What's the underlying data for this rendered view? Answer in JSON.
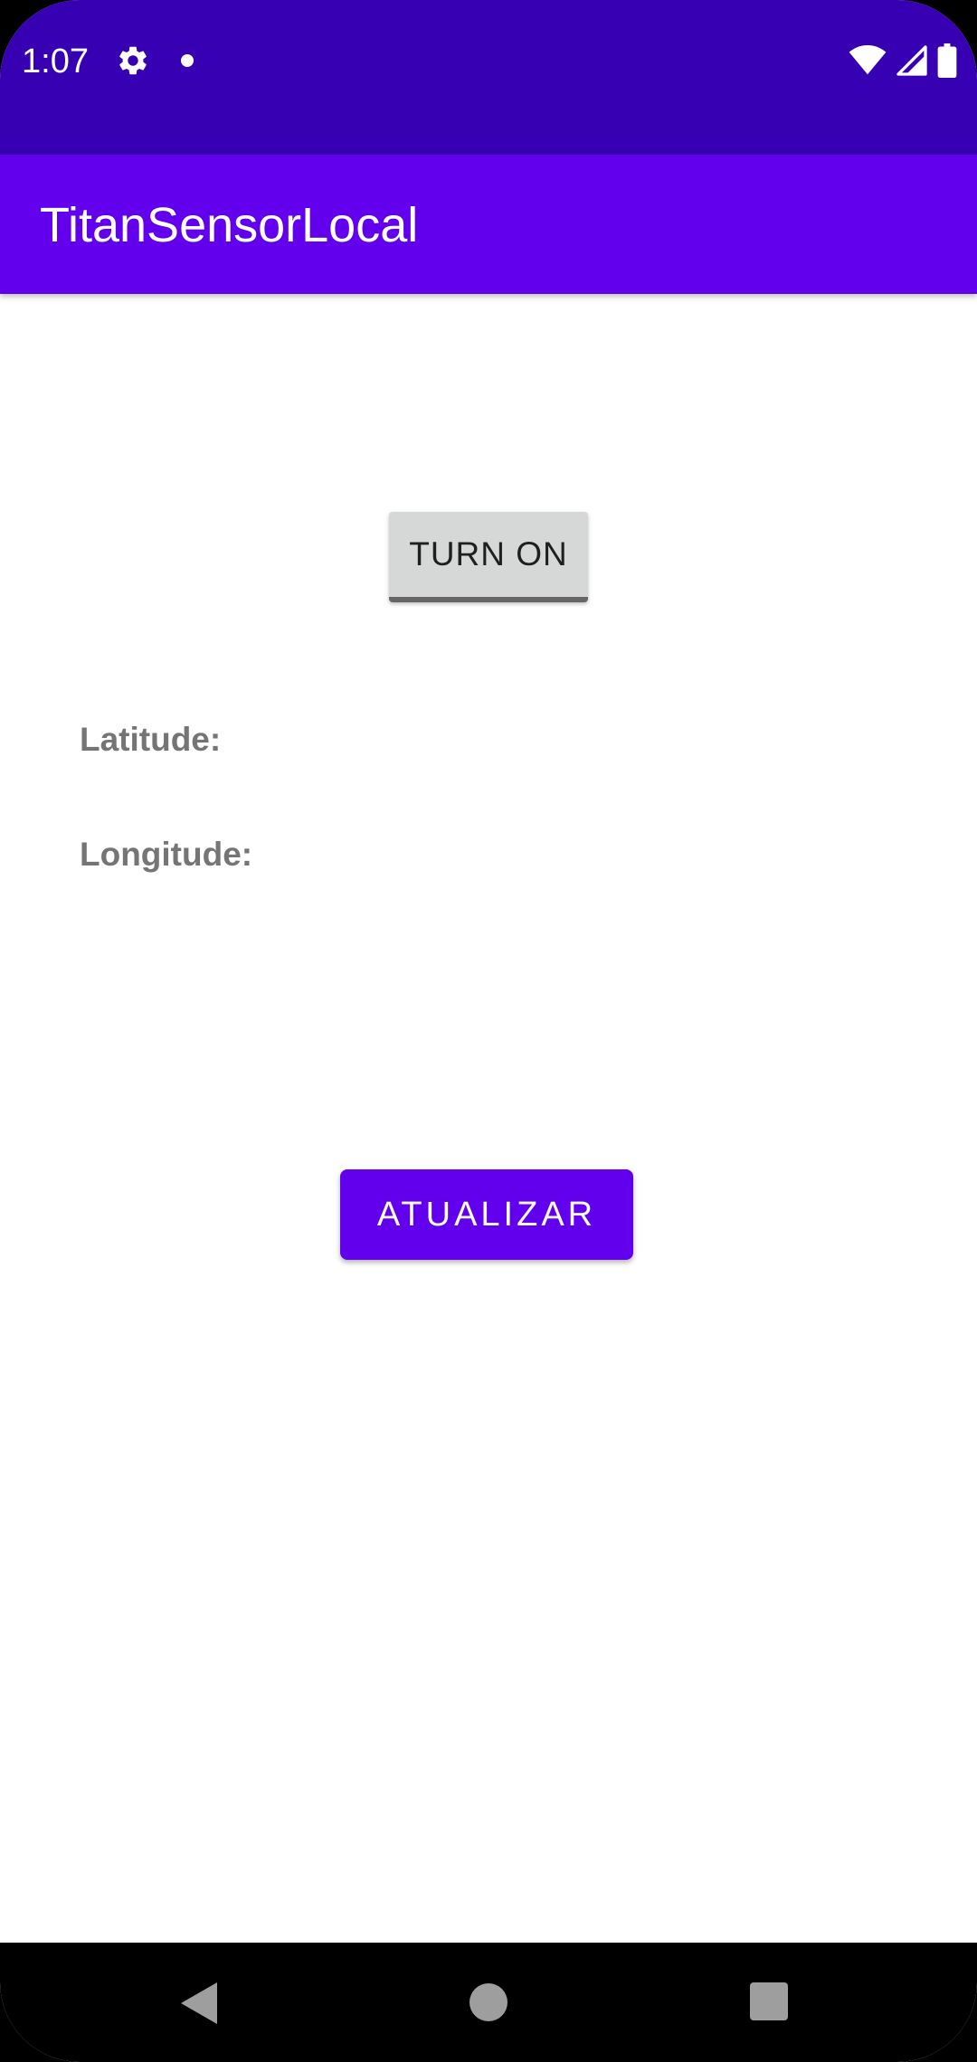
{
  "status_bar": {
    "time": "1:07",
    "icons": [
      "gear-icon",
      "notification-dot-icon",
      "wifi-icon",
      "signal-icon",
      "battery-icon"
    ],
    "background_color": "#3700b3"
  },
  "app_bar": {
    "title": "TitanSensorLocal",
    "background_color": "#6200ee"
  },
  "main": {
    "toggle_button_label": "TURN ON",
    "latitude_label": "Latitude:",
    "longitude_label": "Longitude:",
    "update_button_label": "ATUALIZAR",
    "accent_color": "#6200ee"
  },
  "nav_bar": {
    "icons": [
      "back-icon",
      "home-icon",
      "recents-icon"
    ]
  }
}
